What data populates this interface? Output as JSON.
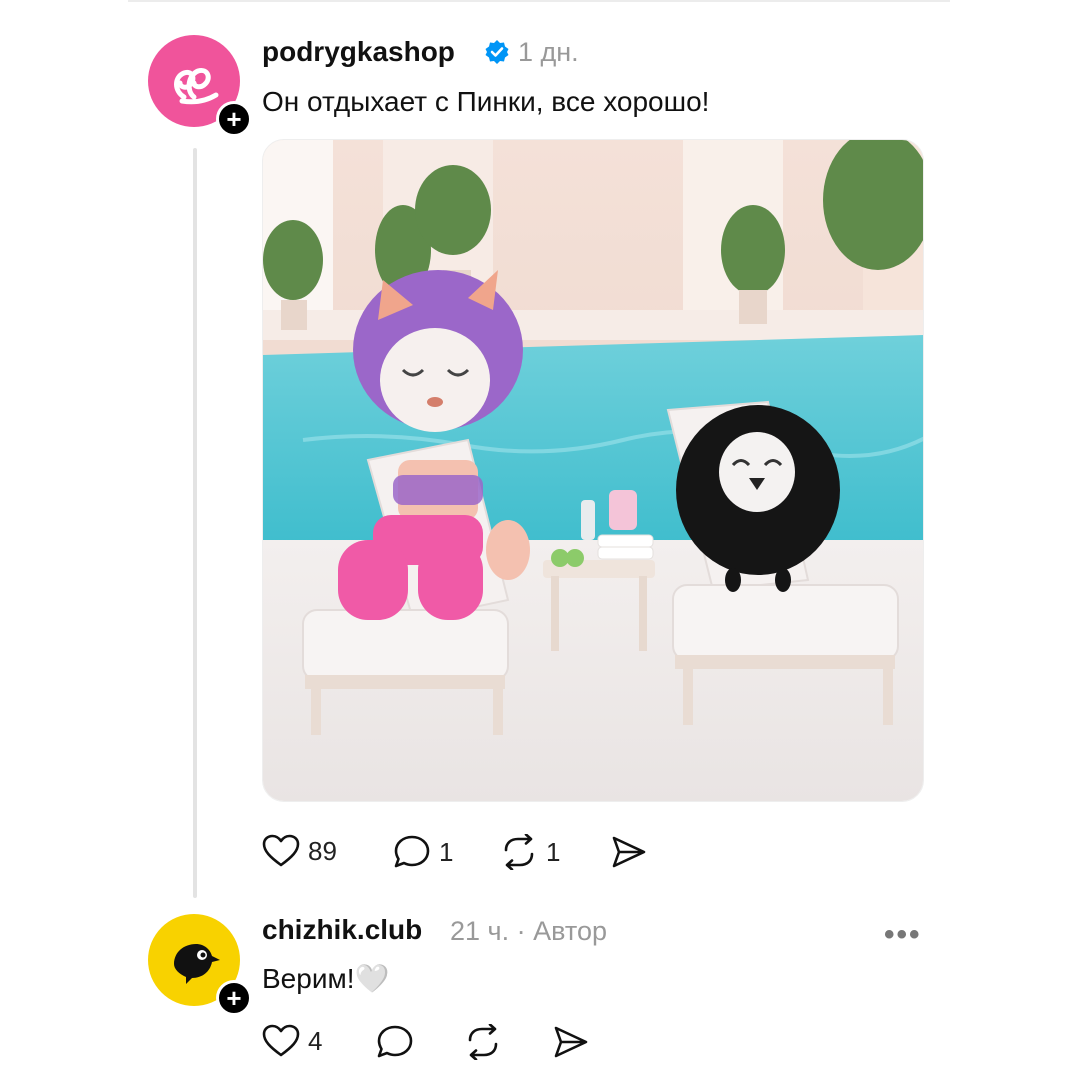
{
  "post": {
    "username": "podrygkashop",
    "time": "1 дн.",
    "text": "Он отдыхает с Пинки, все хорошо!",
    "image_icon": "photo-cat-and-penguin-on-sunbeds-by-pool",
    "actions": {
      "likes": "89",
      "comments": "1",
      "reposts": "1"
    }
  },
  "reply": {
    "username": "chizhik.club",
    "time": "21 ч.",
    "separator": "·",
    "role": "Автор",
    "text": "Верим!🤍",
    "actions": {
      "likes": "4"
    },
    "more": "•••"
  },
  "colors": {
    "brand_pink": "#f0549b",
    "brand_yellow": "#f8d200",
    "verified_blue": "#0095f6"
  }
}
